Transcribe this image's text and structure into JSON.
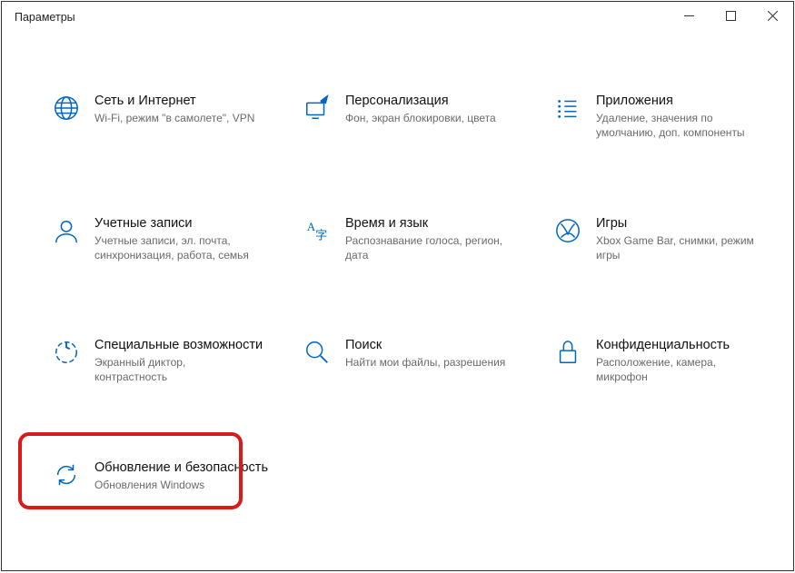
{
  "window": {
    "title": "Параметры"
  },
  "tiles": [
    {
      "title": "Сеть и Интернет",
      "desc": "Wi-Fi, режим \"в самолете\", VPN"
    },
    {
      "title": "Персонализация",
      "desc": "Фон, экран блокировки, цвета"
    },
    {
      "title": "Приложения",
      "desc": "Удаление, значения по умолчанию, доп. компоненты"
    },
    {
      "title": "Учетные записи",
      "desc": "Учетные записи, эл. почта, синхронизация, работа, семья"
    },
    {
      "title": "Время и язык",
      "desc": "Распознавание голоса, регион, дата"
    },
    {
      "title": "Игры",
      "desc": "Xbox Game Bar, снимки, режим игры"
    },
    {
      "title": "Специальные возможности",
      "desc": "Экранный диктор, контрастность"
    },
    {
      "title": "Поиск",
      "desc": "Найти мои файлы, разрешения"
    },
    {
      "title": "Конфиденциальность",
      "desc": "Расположение, камера, микрофон"
    },
    {
      "title": "Обновление и безопасность",
      "desc": "Обновления Windows"
    }
  ]
}
